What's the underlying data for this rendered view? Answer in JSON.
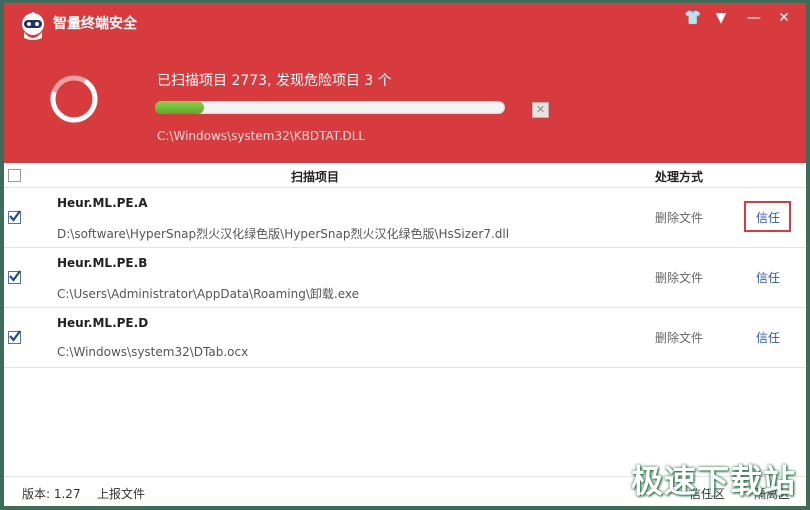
{
  "app": {
    "title": "智量终端安全"
  },
  "window_controls": {
    "skin": "👕",
    "menu": "▼",
    "minimize": "—",
    "close": "✕"
  },
  "scan": {
    "status": "已扫描项目 2773, 发现危险项目 3 个",
    "progress": 0.14,
    "current_file": "C:\\Windows\\system32\\KBDTAT.DLL",
    "cancel": "✕"
  },
  "table": {
    "columns": {
      "item": "扫描项目",
      "action": "处理方式"
    },
    "rows": [
      {
        "name": "Heur.ML.PE.A",
        "path": "D:\\software\\HyperSnap烈火汉化绿色版\\HyperSnap烈火汉化绿色版\\HsSizer7.dll",
        "action": "删除文件",
        "trust": "信任"
      },
      {
        "name": "Heur.ML.PE.B",
        "path": "C:\\Users\\Administrator\\AppData\\Roaming\\卸载.exe",
        "action": "删除文件",
        "trust": "信任"
      },
      {
        "name": "Heur.ML.PE.D",
        "path": "C:\\Windows\\system32\\DTab.ocx",
        "action": "删除文件",
        "trust": "信任"
      }
    ]
  },
  "footer": {
    "version": "版本: 1.27",
    "report": "上报文件",
    "trust_zone": "信任区",
    "quarantine": "隔离区"
  },
  "watermark": "极速下载站",
  "colors": {
    "header": "#d83b3d",
    "link": "#2b57a8",
    "progress": "#6cbb3a"
  }
}
